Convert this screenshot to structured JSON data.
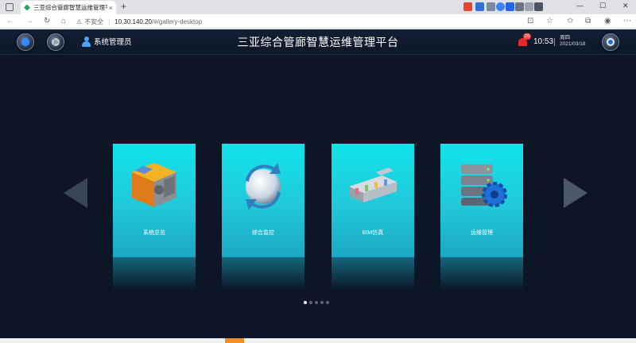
{
  "browser": {
    "tab_title": "三亚综合管廊智慧运维管理平台",
    "tab_close": "×",
    "new_tab": "+",
    "security_label": "不安全",
    "url_host": "10.30.140.20",
    "url_path": "/#/gallery-desktop"
  },
  "header": {
    "username": "系统管理员",
    "title": "三亚综合管廊智慧运维管理平台",
    "alarm_count": "26",
    "time": "10:53",
    "weekday": "周四",
    "date": "2021/03/18"
  },
  "cards": [
    {
      "label": "系统总览",
      "icon": "cube-puzzle-icon"
    },
    {
      "label": "综合监控",
      "icon": "sphere-arrows-icon"
    },
    {
      "label": "BIM仿真",
      "icon": "tunnel-model-icon"
    },
    {
      "label": "运维管理",
      "icon": "server-gear-icon"
    }
  ],
  "pagination": {
    "total": 5,
    "active": 0
  },
  "colors": {
    "app_bg": "#0c1626",
    "card_top": "#11e3ea",
    "card_bottom": "#1aa8c4",
    "alarm": "#e22a2a"
  }
}
